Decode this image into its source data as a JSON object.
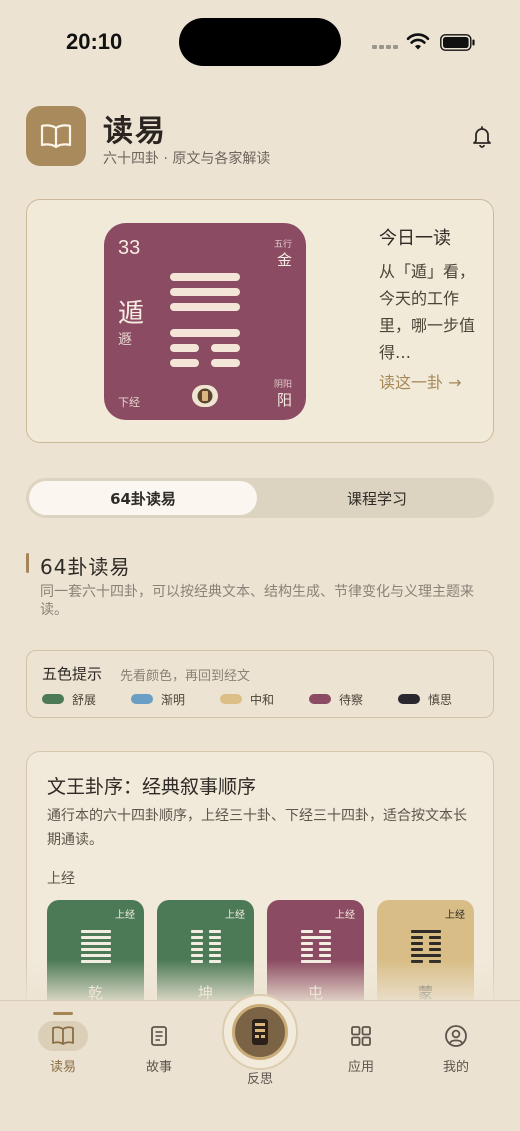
{
  "status_bar": {
    "time": "20:10"
  },
  "header": {
    "title": "读易",
    "subtitle": "六十四卦 · 原文与各家解读",
    "logo_icon": "book-icon",
    "bell_icon": "bell-icon"
  },
  "today": {
    "hexagram": {
      "number": "33",
      "name": "遁",
      "alt_name": "遯",
      "wuxing_label": "五行",
      "wuxing": "金",
      "yinyang_label": "阴阳",
      "yinyang": "阳",
      "part": "下经",
      "color": "#8b4b62",
      "lines_top_to_bottom": [
        "yang",
        "yang",
        "yang",
        "yang",
        "yin",
        "yin"
      ]
    },
    "title": "今日一读",
    "text": "从「遁」看，今天的工作里，哪一步值得…",
    "link": "读这一卦 →"
  },
  "tabs": [
    {
      "label": "64卦读易",
      "active": true
    },
    {
      "label": "课程学习",
      "active": false
    }
  ],
  "section": {
    "title": "64卦读易",
    "desc": "同一套六十四卦，可以按经典文本、结构生成、节律变化与义理主题来读。"
  },
  "legend": {
    "title": "五色提示",
    "hint": "先看颜色，再回到经文",
    "items": [
      {
        "label": "舒展",
        "color": "#4c7a57"
      },
      {
        "label": "渐明",
        "color": "#6a9ec4"
      },
      {
        "label": "中和",
        "color": "#dcbf87"
      },
      {
        "label": "待察",
        "color": "#8b4b62"
      },
      {
        "label": "慎思",
        "color": "#2a2730"
      }
    ]
  },
  "sequence": {
    "title": "文王卦序：经典叙事顺序",
    "desc": "通行本的六十四卦顺序，上经三十卦、下经三十四卦，适合按文本长期通读。",
    "subheading": "上经",
    "items": [
      {
        "name": "乾",
        "tag": "上经",
        "color": "#4c7a57",
        "text_color": "#f3ede2",
        "lines_top_to_bottom": [
          "yang",
          "yang",
          "yang",
          "yang",
          "yang",
          "yang"
        ]
      },
      {
        "name": "坤",
        "tag": "上经",
        "color": "#4c7a57",
        "text_color": "#f3ede2",
        "lines_top_to_bottom": [
          "yin",
          "yin",
          "yin",
          "yin",
          "yin",
          "yin"
        ]
      },
      {
        "name": "屯",
        "tag": "上经",
        "color": "#8b4b62",
        "text_color": "#f3ede2",
        "lines_top_to_bottom": [
          "yin",
          "yang",
          "yin",
          "yin",
          "yin",
          "yang"
        ]
      },
      {
        "name": "蒙",
        "tag": "上经",
        "color": "#d8bd86",
        "text_color": "#2e2a25",
        "lines_top_to_bottom": [
          "yang",
          "yin",
          "yin",
          "yin",
          "yang",
          "yin"
        ]
      }
    ]
  },
  "tab_bar": {
    "items": [
      {
        "label": "读易",
        "icon": "book-open-icon",
        "active": true
      },
      {
        "label": "故事",
        "icon": "notebook-icon",
        "active": false
      },
      {
        "label": "反思",
        "icon": "seal-icon",
        "active": false
      },
      {
        "label": "应用",
        "icon": "grid-icon",
        "active": false
      },
      {
        "label": "我的",
        "icon": "person-icon",
        "active": false
      }
    ]
  }
}
